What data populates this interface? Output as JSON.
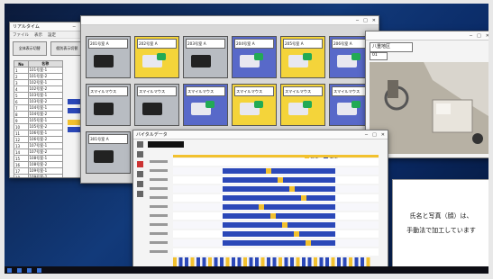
{
  "list_window": {
    "title": "リアルタイム",
    "menu": [
      "ファイル",
      "表示",
      "設定"
    ],
    "buttons": [
      "全体表示切替",
      "個別表示切替"
    ],
    "columns": [
      "No",
      "名称"
    ],
    "rows": [
      [
        "1",
        "101号室-1"
      ],
      [
        "2",
        "101号室-2"
      ],
      [
        "3",
        "102号室-1"
      ],
      [
        "4",
        "102号室-2"
      ],
      [
        "5",
        "103号室-1"
      ],
      [
        "6",
        "103号室-2"
      ],
      [
        "7",
        "104号室-1"
      ],
      [
        "8",
        "104号室-2"
      ],
      [
        "9",
        "105号室-1"
      ],
      [
        "10",
        "105号室-2"
      ],
      [
        "11",
        "106号室-1"
      ],
      [
        "12",
        "106号室-2"
      ],
      [
        "13",
        "107号室-1"
      ],
      [
        "14",
        "107号室-2"
      ],
      [
        "15",
        "108号室-1"
      ],
      [
        "16",
        "108号室-2"
      ],
      [
        "17",
        "109号室-1"
      ],
      [
        "18",
        "109号室-2"
      ],
      [
        "19",
        "110号室-1"
      ],
      [
        "20",
        "110号室-2"
      ],
      [
        "21",
        "111号室-1"
      ],
      [
        "22",
        "111号室-2"
      ],
      [
        "23",
        "112号室-1"
      ]
    ]
  },
  "tiles_window": {
    "tiles": [
      {
        "label": "201号室 A",
        "color": "#b8bcc2"
      },
      {
        "label": "202号室 A",
        "color": "#f4d43a"
      },
      {
        "label": "203号室 A",
        "color": "#b8bcc2"
      },
      {
        "label": "204号室 A",
        "color": "#5869c9"
      },
      {
        "label": "205号室 A",
        "color": "#f4d43a"
      },
      {
        "label": "206号室 A",
        "color": "#5869c9"
      },
      {
        "label": "スマイルマウス",
        "color": "#b8bcc2"
      },
      {
        "label": "スマイルマウス",
        "color": "#b8bcc2"
      },
      {
        "label": "スマイルマウス",
        "color": "#5869c9"
      },
      {
        "label": "スマイルマウス",
        "color": "#f4d43a"
      },
      {
        "label": "スマイルマウス",
        "color": "#f4d43a"
      },
      {
        "label": "スマイルマウス",
        "color": "#5869c9"
      },
      {
        "label": "301号室 A",
        "color": "#b8bcc2"
      }
    ]
  },
  "camera_window": {
    "title": "八重地区",
    "value": "01"
  },
  "chart_window": {
    "title": "バイタルデータ",
    "legend": [
      "離床",
      "在床",
      "不在"
    ],
    "colors": {
      "in_bed": "#2b48b8",
      "out": "#f2c12e"
    }
  },
  "notice": {
    "line1": "氏名と写真（顔）は、",
    "line2": "手動法で加工しています"
  }
}
